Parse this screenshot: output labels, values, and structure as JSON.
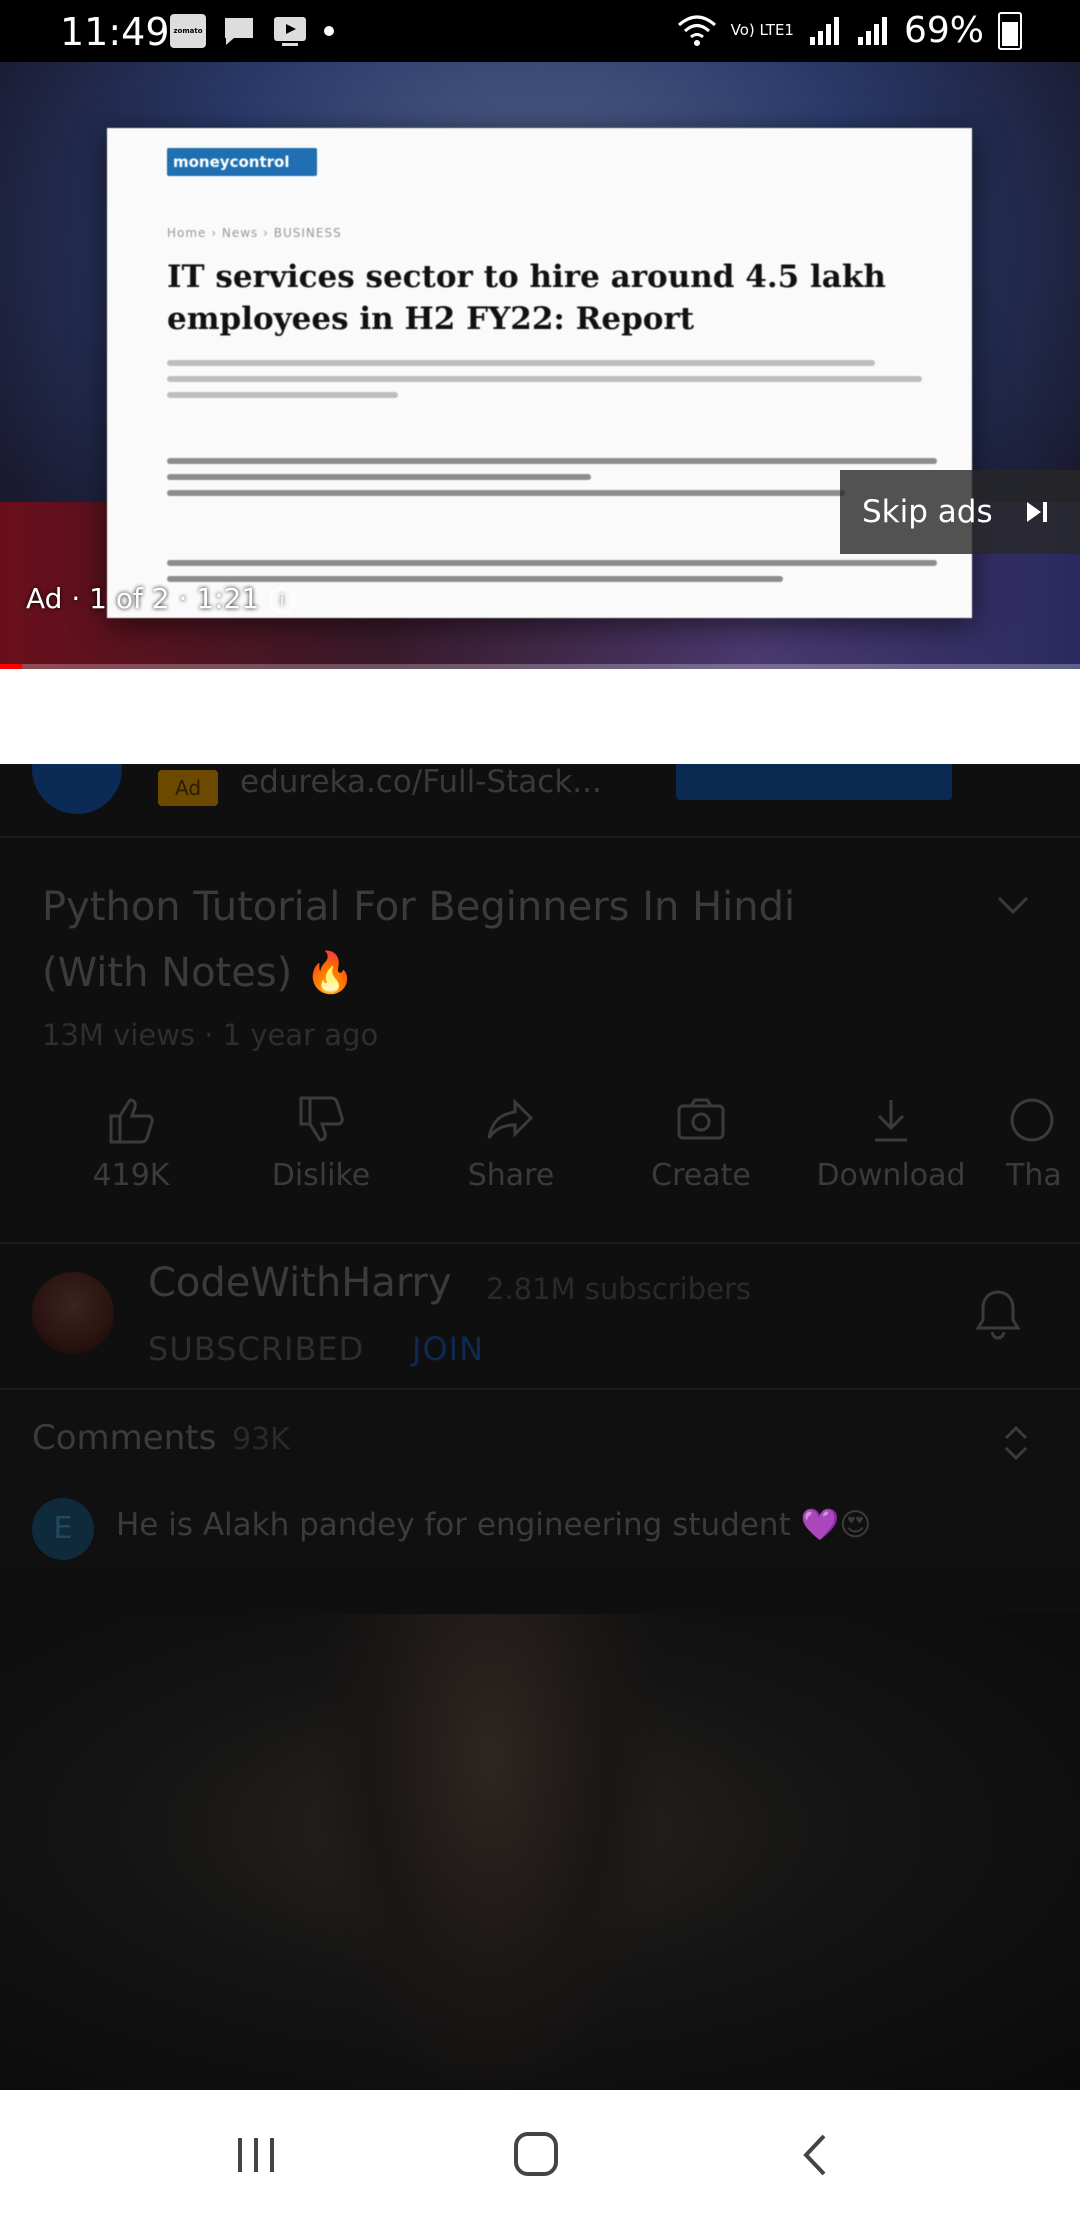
{
  "status_bar": {
    "time": "11:49",
    "battery": "69%",
    "notif_app": "zomato",
    "network": "Vo) LTE1"
  },
  "ad_player": {
    "article": {
      "logo": "moneycontrol",
      "breadcrumb": "Home › News › BUSINESS",
      "breadcrumb_section": "BUSINESS",
      "headline": "IT services sector to hire around 4.5 lakh employees in H2 FY22: Report"
    },
    "ad_label": "Ad · 1 of 2 · 1:21",
    "skip_label": "Skip ads",
    "progress_fraction": 0.02
  },
  "ad_row": {
    "badge": "Ad",
    "url": "edureka.co/Full-Stack..."
  },
  "video": {
    "title": "Python Tutorial For Beginners In Hindi (With Notes) 🔥",
    "meta": "13M views · 1 year ago"
  },
  "actions": [
    {
      "label": "419K",
      "icon": "thumbs-up-icon"
    },
    {
      "label": "Dislike",
      "icon": "thumbs-down-icon"
    },
    {
      "label": "Share",
      "icon": "share-icon"
    },
    {
      "label": "Create",
      "icon": "create-icon"
    },
    {
      "label": "Download",
      "icon": "download-icon"
    },
    {
      "label": "Tha",
      "icon": "thanks-icon"
    }
  ],
  "channel": {
    "name": "CodeWithHarry",
    "subscribers": "2.81M subscribers",
    "subscribed_label": "SUBSCRIBED",
    "join_label": "JOIN"
  },
  "comments": {
    "title": "Comments",
    "count": "93K",
    "first_initial": "E",
    "first_text": "He is Alakh pandey for engineering student",
    "first_emoji": "💜😍"
  },
  "colors": {
    "accent_red": "#ff0000",
    "join_blue": "#0d2a52",
    "overlay_bg": "#0f0f0f"
  }
}
